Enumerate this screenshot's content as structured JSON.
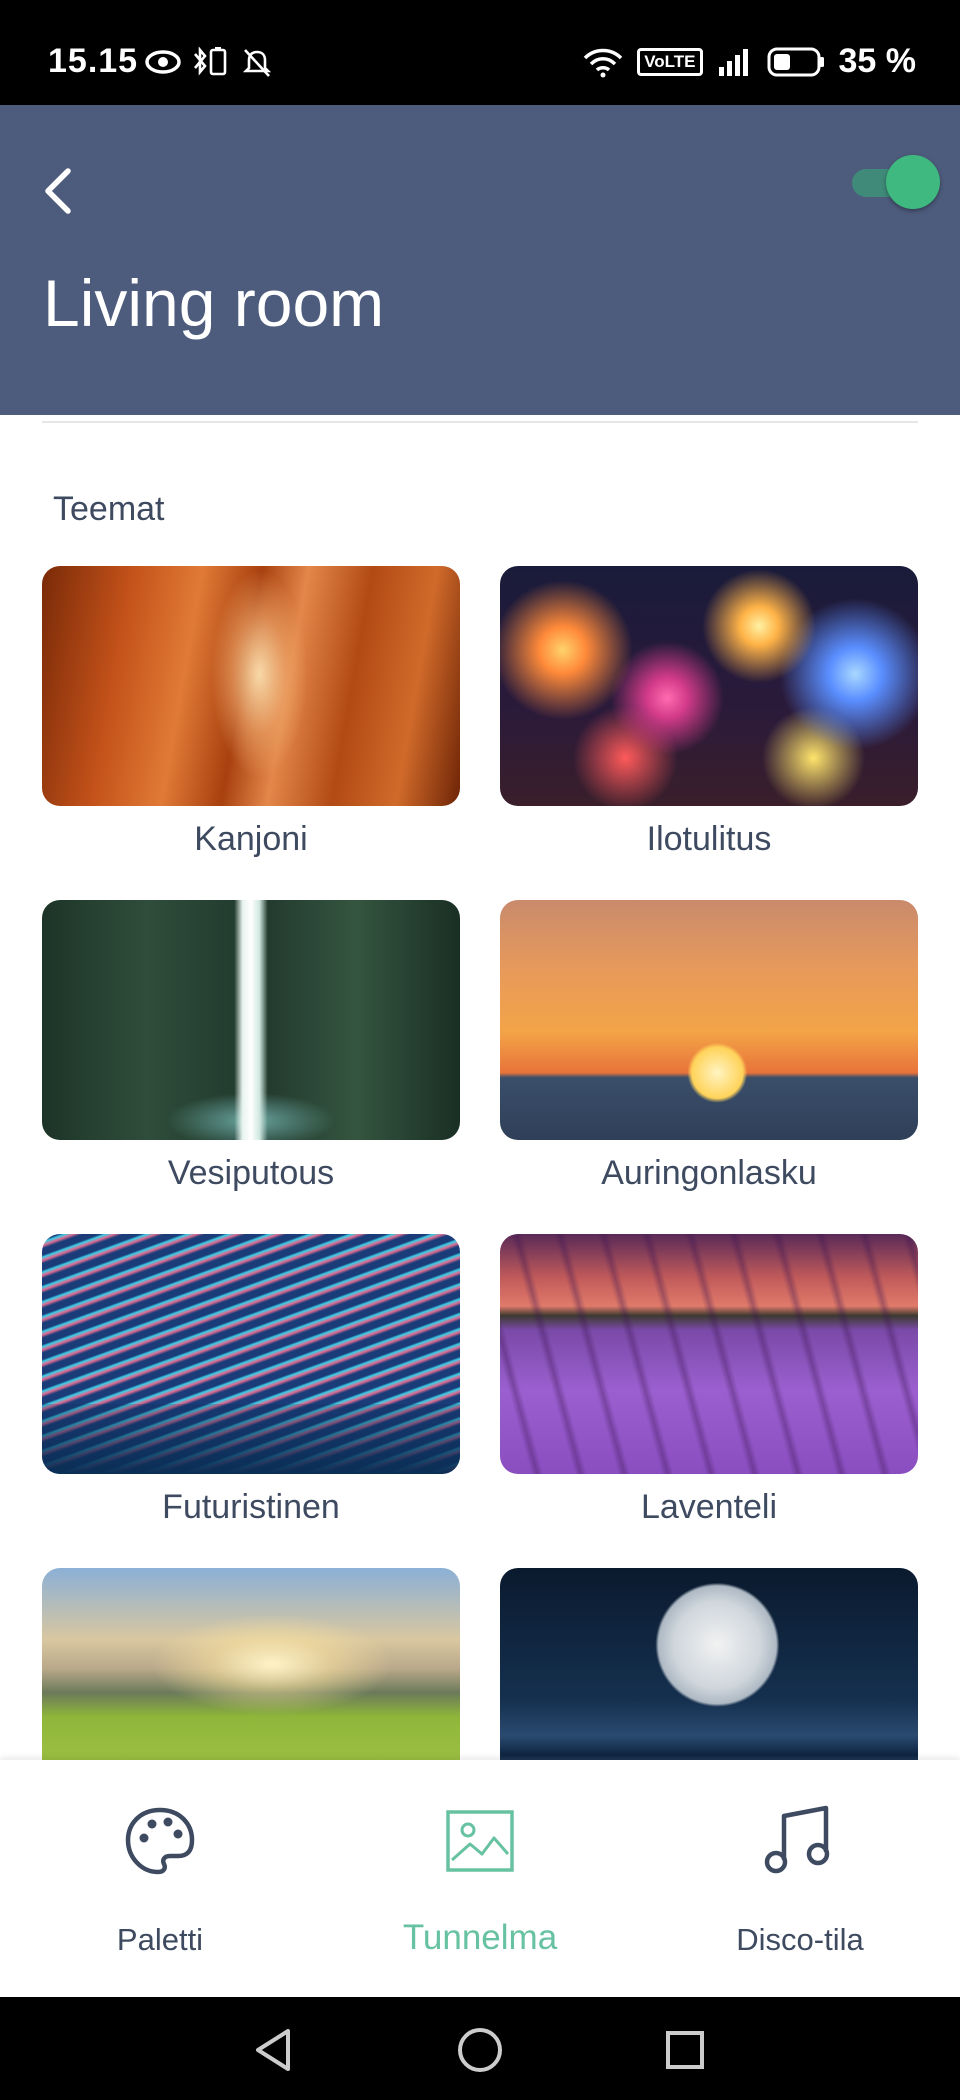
{
  "status_bar": {
    "time": "15.15",
    "volte": "VoLTE",
    "battery": "35 %",
    "icons": [
      "eye-icon",
      "bluetooth-battery-icon",
      "bell-off-icon",
      "wifi-icon",
      "volte-icon",
      "signal-icon",
      "battery-icon"
    ]
  },
  "header": {
    "title": "Living room",
    "toggle_on": true,
    "background": "#4d5b7c",
    "toggle_color": "#3fb97f"
  },
  "section": {
    "title": "Teemat"
  },
  "themes": [
    {
      "label": "Kanjoni"
    },
    {
      "label": "Ilotulitus"
    },
    {
      "label": "Vesiputous"
    },
    {
      "label": "Auringonlasku"
    },
    {
      "label": "Futuristinen"
    },
    {
      "label": "Laventeli"
    },
    {
      "label": ""
    },
    {
      "label": ""
    }
  ],
  "bottom_nav": {
    "items": [
      {
        "label": "Paletti",
        "icon": "palette-icon",
        "active": false
      },
      {
        "label": "Tunnelma",
        "icon": "image-icon",
        "active": true
      },
      {
        "label": "Disco-tila",
        "icon": "music-note-icon",
        "active": false
      }
    ],
    "active_color": "#66c2a0",
    "inactive_color": "#3e4a60"
  },
  "system_nav": {
    "icons": [
      "back-triangle-icon",
      "home-circle-icon",
      "recents-square-icon"
    ]
  }
}
